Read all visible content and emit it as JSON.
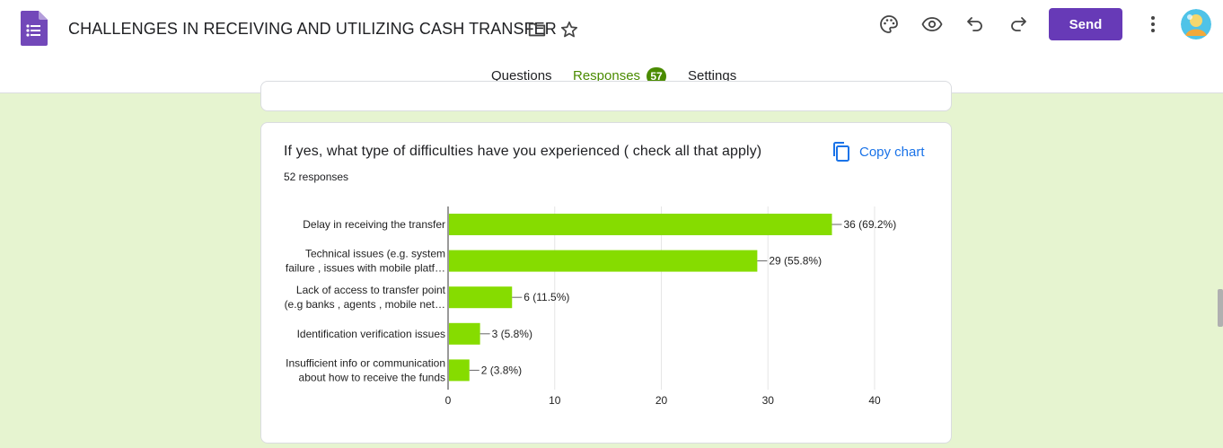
{
  "app": {
    "title": "CHALLENGES IN RECEIVING AND UTILIZING CASH TRANSFER",
    "icons": [
      "forms-logo-icon",
      "folder-icon",
      "star-icon",
      "palette-icon",
      "eye-icon",
      "undo-icon",
      "redo-icon",
      "more-vert-icon"
    ],
    "send_label": "Send",
    "brand_color": "#673ab7",
    "accent_color": "#4a8b00"
  },
  "tabs": [
    {
      "label": "Questions"
    },
    {
      "label": "Responses",
      "badge": "57"
    },
    {
      "label": "Settings"
    }
  ],
  "question": {
    "title": "If yes, what type of difficulties have you experienced ( check all that apply)",
    "responses": "52 responses",
    "copy_label": "Copy chart"
  },
  "chart_data": {
    "type": "bar",
    "orientation": "horizontal",
    "categories": [
      [
        "Delay in receiving the transfer"
      ],
      [
        "Technical issues (e.g. system",
        "failure , issues with mobile platf…"
      ],
      [
        "Lack of access to transfer point",
        "(e.g banks , agents , mobile net…"
      ],
      [
        "Identification verification issues"
      ],
      [
        "Insufficient info or communication",
        "about how to receive the funds"
      ]
    ],
    "values": [
      36,
      29,
      6,
      3,
      2
    ],
    "labels": [
      "36 (69.2%)",
      "29 (55.8%)",
      "6 (11.5%)",
      "3 (5.8%)",
      "2 (3.8%)"
    ],
    "xlim": [
      0,
      40
    ],
    "xticks": [
      0,
      10,
      20,
      30,
      40
    ],
    "bar_color": "#86dc00",
    "grid": true
  }
}
